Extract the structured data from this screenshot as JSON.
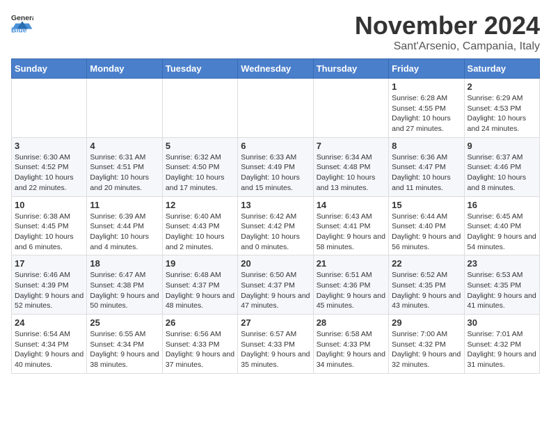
{
  "header": {
    "logo_general": "General",
    "logo_blue": "Blue",
    "month_title": "November 2024",
    "location": "Sant'Arsenio, Campania, Italy"
  },
  "days_of_week": [
    "Sunday",
    "Monday",
    "Tuesday",
    "Wednesday",
    "Thursday",
    "Friday",
    "Saturday"
  ],
  "weeks": [
    [
      {
        "day": "",
        "info": ""
      },
      {
        "day": "",
        "info": ""
      },
      {
        "day": "",
        "info": ""
      },
      {
        "day": "",
        "info": ""
      },
      {
        "day": "",
        "info": ""
      },
      {
        "day": "1",
        "info": "Sunrise: 6:28 AM\nSunset: 4:55 PM\nDaylight: 10 hours and 27 minutes."
      },
      {
        "day": "2",
        "info": "Sunrise: 6:29 AM\nSunset: 4:53 PM\nDaylight: 10 hours and 24 minutes."
      }
    ],
    [
      {
        "day": "3",
        "info": "Sunrise: 6:30 AM\nSunset: 4:52 PM\nDaylight: 10 hours and 22 minutes."
      },
      {
        "day": "4",
        "info": "Sunrise: 6:31 AM\nSunset: 4:51 PM\nDaylight: 10 hours and 20 minutes."
      },
      {
        "day": "5",
        "info": "Sunrise: 6:32 AM\nSunset: 4:50 PM\nDaylight: 10 hours and 17 minutes."
      },
      {
        "day": "6",
        "info": "Sunrise: 6:33 AM\nSunset: 4:49 PM\nDaylight: 10 hours and 15 minutes."
      },
      {
        "day": "7",
        "info": "Sunrise: 6:34 AM\nSunset: 4:48 PM\nDaylight: 10 hours and 13 minutes."
      },
      {
        "day": "8",
        "info": "Sunrise: 6:36 AM\nSunset: 4:47 PM\nDaylight: 10 hours and 11 minutes."
      },
      {
        "day": "9",
        "info": "Sunrise: 6:37 AM\nSunset: 4:46 PM\nDaylight: 10 hours and 8 minutes."
      }
    ],
    [
      {
        "day": "10",
        "info": "Sunrise: 6:38 AM\nSunset: 4:45 PM\nDaylight: 10 hours and 6 minutes."
      },
      {
        "day": "11",
        "info": "Sunrise: 6:39 AM\nSunset: 4:44 PM\nDaylight: 10 hours and 4 minutes."
      },
      {
        "day": "12",
        "info": "Sunrise: 6:40 AM\nSunset: 4:43 PM\nDaylight: 10 hours and 2 minutes."
      },
      {
        "day": "13",
        "info": "Sunrise: 6:42 AM\nSunset: 4:42 PM\nDaylight: 10 hours and 0 minutes."
      },
      {
        "day": "14",
        "info": "Sunrise: 6:43 AM\nSunset: 4:41 PM\nDaylight: 9 hours and 58 minutes."
      },
      {
        "day": "15",
        "info": "Sunrise: 6:44 AM\nSunset: 4:40 PM\nDaylight: 9 hours and 56 minutes."
      },
      {
        "day": "16",
        "info": "Sunrise: 6:45 AM\nSunset: 4:40 PM\nDaylight: 9 hours and 54 minutes."
      }
    ],
    [
      {
        "day": "17",
        "info": "Sunrise: 6:46 AM\nSunset: 4:39 PM\nDaylight: 9 hours and 52 minutes."
      },
      {
        "day": "18",
        "info": "Sunrise: 6:47 AM\nSunset: 4:38 PM\nDaylight: 9 hours and 50 minutes."
      },
      {
        "day": "19",
        "info": "Sunrise: 6:48 AM\nSunset: 4:37 PM\nDaylight: 9 hours and 48 minutes."
      },
      {
        "day": "20",
        "info": "Sunrise: 6:50 AM\nSunset: 4:37 PM\nDaylight: 9 hours and 47 minutes."
      },
      {
        "day": "21",
        "info": "Sunrise: 6:51 AM\nSunset: 4:36 PM\nDaylight: 9 hours and 45 minutes."
      },
      {
        "day": "22",
        "info": "Sunrise: 6:52 AM\nSunset: 4:35 PM\nDaylight: 9 hours and 43 minutes."
      },
      {
        "day": "23",
        "info": "Sunrise: 6:53 AM\nSunset: 4:35 PM\nDaylight: 9 hours and 41 minutes."
      }
    ],
    [
      {
        "day": "24",
        "info": "Sunrise: 6:54 AM\nSunset: 4:34 PM\nDaylight: 9 hours and 40 minutes."
      },
      {
        "day": "25",
        "info": "Sunrise: 6:55 AM\nSunset: 4:34 PM\nDaylight: 9 hours and 38 minutes."
      },
      {
        "day": "26",
        "info": "Sunrise: 6:56 AM\nSunset: 4:33 PM\nDaylight: 9 hours and 37 minutes."
      },
      {
        "day": "27",
        "info": "Sunrise: 6:57 AM\nSunset: 4:33 PM\nDaylight: 9 hours and 35 minutes."
      },
      {
        "day": "28",
        "info": "Sunrise: 6:58 AM\nSunset: 4:33 PM\nDaylight: 9 hours and 34 minutes."
      },
      {
        "day": "29",
        "info": "Sunrise: 7:00 AM\nSunset: 4:32 PM\nDaylight: 9 hours and 32 minutes."
      },
      {
        "day": "30",
        "info": "Sunrise: 7:01 AM\nSunset: 4:32 PM\nDaylight: 9 hours and 31 minutes."
      }
    ]
  ]
}
